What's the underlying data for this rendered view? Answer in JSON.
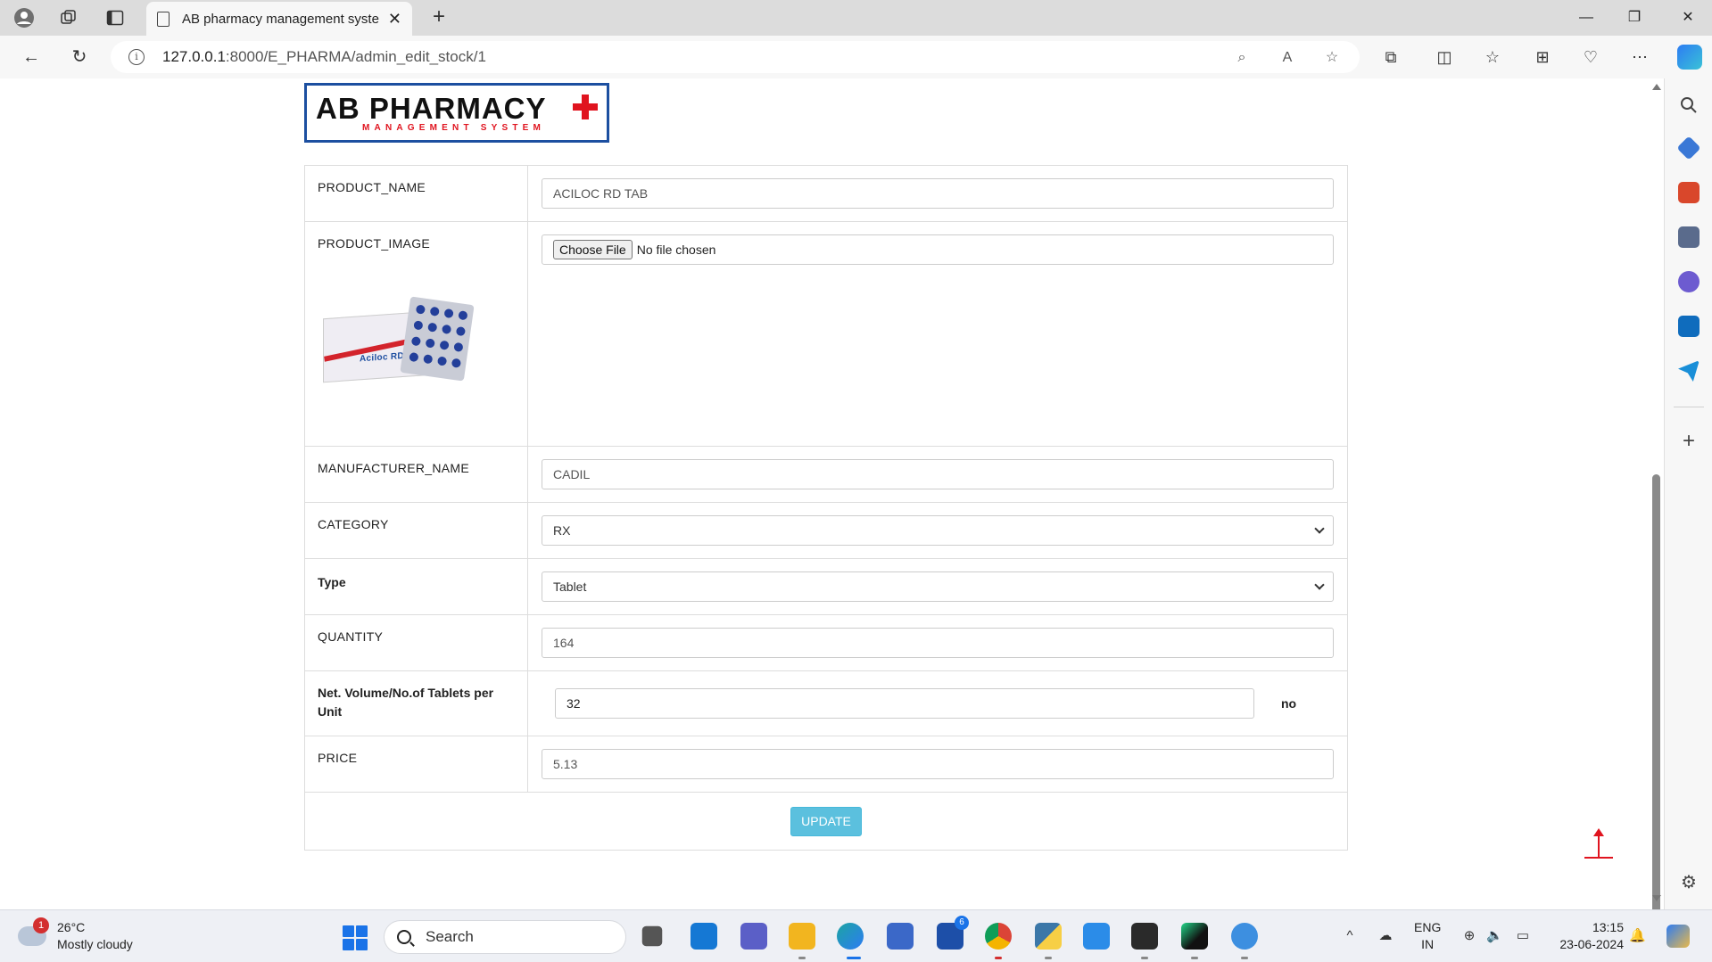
{
  "browser": {
    "tab_title": "AB pharmacy management syste",
    "url_host": "127.0.0.1",
    "url_path": ":8000/E_PHARMA/admin_edit_stock/1"
  },
  "logo": {
    "main_text": "AB PHARMACY",
    "sub_text": "MANAGEMENT SYSTEM",
    "brand_color": "#1c4fa0",
    "accent_color": "#e0141f"
  },
  "form": {
    "product_name": {
      "label": "PRODUCT_NAME",
      "value": "ACILOC RD TAB"
    },
    "product_image": {
      "label": "PRODUCT_IMAGE",
      "button": "Choose File",
      "status": "No file chosen",
      "image_caption": "Aciloc RD"
    },
    "manufacturer": {
      "label": "MANUFACTURER_NAME",
      "value": "CADIL"
    },
    "category": {
      "label": "CATEGORY",
      "value": "RX"
    },
    "type": {
      "label": "Type",
      "value": "Tablet"
    },
    "quantity": {
      "label": "QUANTITY",
      "value": "164"
    },
    "net_volume": {
      "label": "Net. Volume/No.of Tablets per Unit",
      "value": "32",
      "unit": "no"
    },
    "price": {
      "label": "PRICE",
      "value": "5.13"
    },
    "submit_label": "UPDATE",
    "submit_color": "#5bc0de"
  },
  "taskbar": {
    "weather_temp": "26°C",
    "weather_desc": "Mostly cloudy",
    "weather_badge": "1",
    "search_label": "Search",
    "lang_line1": "ENG",
    "lang_line2": "IN",
    "time": "13:15",
    "date": "23-06-2024",
    "app_badge": "6"
  }
}
